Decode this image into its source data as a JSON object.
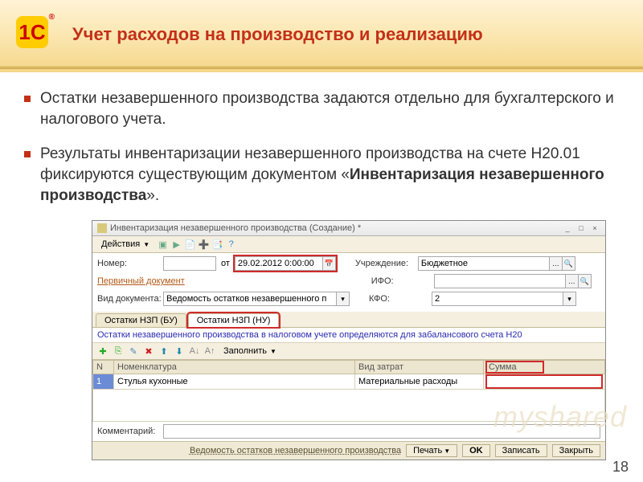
{
  "header": {
    "logo_text": "1С",
    "title": "Учет расходов на производство и реализацию"
  },
  "bullets": {
    "item1": "Остатки незавершенного производства задаются отдельно для бухгалтерского и налогового учета.",
    "item2_pre": "Результаты инвентаризации незавершенного производства на счете Н20.01 фиксируются существующим документом «",
    "item2_strong": "Инвентаризация незавершенного производства",
    "item2_post": "»."
  },
  "window": {
    "title": "Инвентаризация незавершенного производства (Создание) *",
    "actions_label": "Действия",
    "form": {
      "number_label": "Номер:",
      "number_value": "",
      "from": "от",
      "date_value": "29.02.2012 0:00:00",
      "institution_label": "Учреждение:",
      "institution_value": "Бюджетное",
      "primary_doc_label": "Первичный документ",
      "ifo_label": "ИФО:",
      "ifo_value": "",
      "doctype_label": "Вид документа:",
      "doctype_value": "Ведомость остатков незавершенного п",
      "kfo_label": "КФО:",
      "kfo_value": "2"
    },
    "tabs": {
      "tab_bu": "Остатки НЗП (БУ)",
      "tab_nu": "Остатки НЗП (НУ)"
    },
    "hint": "Остатки незавершенного производства в налоговом учете определяются для забалансового счета Н20",
    "toolbar": {
      "fill": "Заполнить"
    },
    "columns": {
      "n": "N",
      "nomen": "Номенклатура",
      "cost_type": "Вид затрат",
      "sum": "Сумма"
    },
    "rows": [
      {
        "n": "1",
        "nomen": "Стулья кухонные",
        "cost_type": "Материальные расходы",
        "sum": ""
      }
    ],
    "comment_label": "Комментарий:",
    "comment_value": "",
    "bottom": {
      "link": "Ведомость остатков незавершенного производства",
      "print": "Печать",
      "ok": "OK",
      "save": "Записать",
      "close": "Закрыть"
    }
  },
  "page_number": "18",
  "watermark": "myshared"
}
